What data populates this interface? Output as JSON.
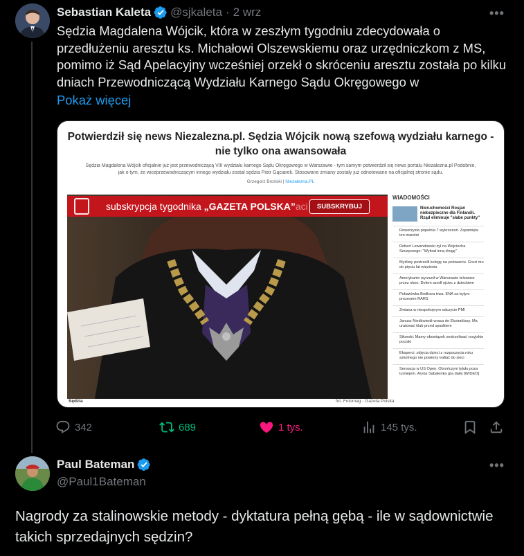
{
  "tweet": {
    "author_name": "Sebastian Kaleta",
    "author_handle": "@sjkaleta",
    "separator": "·",
    "date": "2 wrz",
    "text": "Sędzia Magdalena Wójcik, która w zeszłym tygodniu zdecydowała o przedłużeniu aresztu ks. Michałowi Olszewskiemu oraz urzędniczkom z MS, pomimo iż Sąd Apelacyjny wcześniej orzekł o skróceniu aresztu została po kilku dniach Przewodniczącą Wydziału Karnego Sądu Okręgowego w",
    "show_more": "Pokaż więcej",
    "more_menu": "•••",
    "stats": {
      "replies": "342",
      "reposts": "689",
      "likes": "1 tys.",
      "views": "145 tys."
    }
  },
  "article": {
    "title": "Potwierdził się news Niezalezna.pl. Sędzia Wójcik nową szefową wydziału karnego - nie tylko ona awansowała",
    "lead": "Sędzia Magdalena Wójcik oficjalnie już jest przewodniczącą VIII wydziału karnego Sądu Okręgowego w Warszawie - tym samym potwierdził się news portalu Niezalezna.pl Podobnie, jak o tym, że wiceprzewodniczącym innego wydziału został sędzia Piotr Gąciarek. Stosowane zmiany zostały już odnotowane na oficjalnej stronie sądu.",
    "author": "Grzegorz Broński",
    "author_sep": " | ",
    "author_link": "Niezalezna.PL",
    "banner_prefix": "subskrypcja tygodnika ",
    "banner_brand": "„GAZETA POLSKA”",
    "banner_suffix": "aci",
    "banner_button": "SUBSKRYBUJ",
    "caption_left": "Sędzia",
    "caption_right": "fot. Fotomag - Gazeta Polska",
    "sidebar_title": "WIADOMOŚCI",
    "sidebar_feature": "Nieruchomości Rosjan niebezpieczne dla Finlandii. Rząd eliminuje \"słabe punkty\"",
    "sidebar_items": [
      "Rowerzysta popełnia 7 wykroczeń. Zapamięta ten mandat",
      "Robert Lewandowski żył na Wojciecha Szczęsnego: \"Wybrał inną drogę\"",
      "Myśliwy postrzelił kolegę na polowaniu. Grozi mu do pięciu lat więzienia",
      "Amerykanin wyrzucił w Warszawie telewizor przez okno. Dolem szedł ojciec z dzieckiem",
      "Pokażówka Bodhara trwa. ENA za byłym prezesem RARS",
      "Zmiana w niespokojnym odczycie PMI",
      "Janusz Niedźwiedź wraca do Ekstraklasy. Ma uratować klub przed spadkiem",
      "Sikorski: Mamy obowiązek zestrzeliwać rosyjskie pociski",
      "Eksperci: zdjęcia dzieci z rozpoczęcia roku szkolnego nie powinny trafiać do sieci",
      "Sensacja w US Open. Obrończyni tytułu poza turniejem. Aryna Sabalenka gra dalej [WIDEO]"
    ]
  },
  "reply": {
    "author_name": "Paul Bateman",
    "author_handle": "@Paul1Bateman",
    "more_menu": "•••",
    "text": "Nagrody za stalinowskie metody - dyktatura pełną gębą - ile w sądownictwie takich sprzedajnych sędzin?"
  },
  "colors": {
    "background": "#000000",
    "text": "#e7e9ea",
    "muted": "#71767b",
    "link": "#1d9bf0",
    "verified": "#1d9bf0",
    "repost": "#00ba7c",
    "like": "#f91880",
    "banner": "#c3151c"
  },
  "icons": [
    "verified-badge-icon",
    "more-icon",
    "reply-icon",
    "repost-icon",
    "heart-icon",
    "views-icon",
    "bookmark-icon",
    "share-icon"
  ]
}
